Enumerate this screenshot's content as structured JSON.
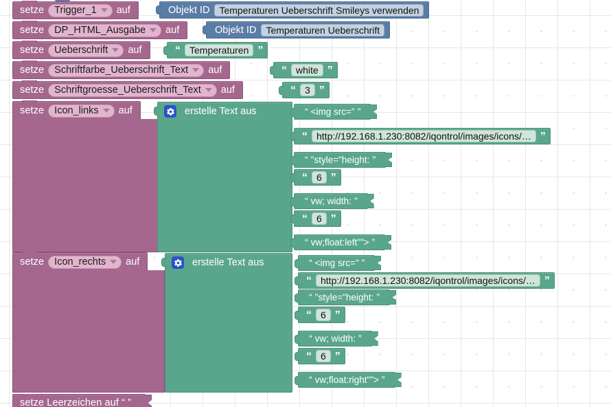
{
  "workspace": {
    "language": "de",
    "keywords": {
      "set": "setze",
      "to": "auf"
    },
    "colors": {
      "variable_block": "#a5678e",
      "variable_field": "#e2b5ce",
      "text_block": "#5aa68d",
      "text_field": "#cfe5da",
      "object_id_block": "#5a7ca5",
      "object_id_field": "#c3d2e2",
      "mutator_gear": "#2a52c9",
      "canvas": "#ffffff"
    }
  },
  "rows": [
    {
      "id": "row-trigger1",
      "keyword": "setze",
      "variable": "Trigger_1",
      "to": "auf",
      "value_kind": "object-id",
      "value_label": "Objekt ID",
      "value": "Temperaturen Ueberschrift Smileys verwenden"
    },
    {
      "id": "row-dp-html-ausgabe",
      "keyword": "setze",
      "variable": "DP_HTML_Ausgabe",
      "to": "auf",
      "value_kind": "object-id",
      "value_label": "Objekt ID",
      "value": "Temperaturen Ueberschrift"
    },
    {
      "id": "row-ueberschrift",
      "keyword": "setze",
      "variable": "Ueberschrift",
      "to": "auf",
      "value_kind": "text",
      "value": "Temperaturen"
    },
    {
      "id": "row-schriftfarbe",
      "keyword": "setze",
      "variable": "Schriftfarbe_Ueberschrift_Text",
      "to": "auf",
      "value_kind": "text",
      "value": "white"
    },
    {
      "id": "row-schriftgroesse",
      "keyword": "setze",
      "variable": "Schriftgroesse_Ueberschrift_Text",
      "to": "auf",
      "value_kind": "text",
      "value": "3"
    }
  ],
  "icon_links": {
    "id": "row-icon-links",
    "keyword": "setze",
    "variable": "Icon_links",
    "to": "auf",
    "join_label": "erstelle Text aus",
    "mutator_icon": "gear-icon",
    "parts": [
      {
        "kind": "plain",
        "text": "<img src=\""
      },
      {
        "kind": "field",
        "text": "http://192.168.1.230:8082/iqontrol/images/icons/…"
      },
      {
        "kind": "plain",
        "text": "\"style=\"height: "
      },
      {
        "kind": "field",
        "text": "6"
      },
      {
        "kind": "plain",
        "text": "vw; width: "
      },
      {
        "kind": "field",
        "text": "6"
      },
      {
        "kind": "plain",
        "text": "vw;float:left\"\"> "
      }
    ]
  },
  "icon_rechts": {
    "id": "row-icon-rechts",
    "keyword": "setze",
    "variable": "Icon_rechts",
    "to": "auf",
    "join_label": "erstelle Text aus",
    "mutator_icon": "gear-icon",
    "parts": [
      {
        "kind": "plain",
        "text": "<img src=\""
      },
      {
        "kind": "field",
        "text": "http://192.168.1.230:8082/iqontrol/images/icons/…"
      },
      {
        "kind": "plain",
        "text": "\"style=\"height: "
      },
      {
        "kind": "field",
        "text": "6"
      },
      {
        "kind": "plain",
        "text": "vw; width: "
      },
      {
        "kind": "field",
        "text": "6"
      },
      {
        "kind": "plain",
        "text": "vw;float:right\"\"> "
      }
    ]
  },
  "last_row": {
    "id": "row-leerzeichen",
    "text": "setze Leerzeichen auf “   ”"
  }
}
